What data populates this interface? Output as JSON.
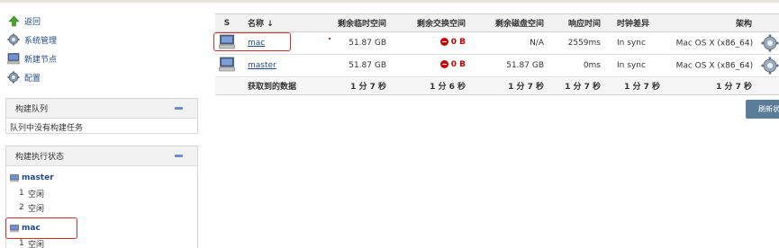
{
  "sidebar": {
    "tasks": [
      {
        "label": "返回",
        "icon": "up-arrow-icon"
      },
      {
        "label": "系统管理",
        "icon": "gear-icon"
      },
      {
        "label": "新建节点",
        "icon": "computer-icon"
      },
      {
        "label": "配置",
        "icon": "gear-icon"
      }
    ],
    "build_queue": {
      "title": "构建队列",
      "empty_text": "队列中没有构建任务"
    },
    "executor_status": {
      "title": "构建执行状态",
      "nodes": [
        {
          "name": "master",
          "executors": [
            {
              "num": "1",
              "state": "空闲"
            },
            {
              "num": "2",
              "state": "空闲"
            }
          ]
        },
        {
          "name": "mac",
          "executors": [
            {
              "num": "1",
              "state": "空闲"
            }
          ]
        }
      ]
    }
  },
  "table": {
    "headers": {
      "s": "S",
      "name": "名称 ↓",
      "temp": "剩余临时空间",
      "swap": "剩余交换空间",
      "disk": "剩余磁盘空间",
      "response": "响应时间",
      "clock": "时钟差异",
      "arch": "架构"
    },
    "rows": [
      {
        "name": "mac",
        "temp": "51.87 GB",
        "swap": "0 B",
        "disk": "N/A",
        "response": "2559ms",
        "clock": "In sync",
        "arch": "Mac OS X (x86_64)"
      },
      {
        "name": "master",
        "temp": "51.87 GB",
        "swap": "0 B",
        "disk": "51.87 GB",
        "response": "0ms",
        "clock": "In sync",
        "arch": "Mac OS X (x86_64)"
      }
    ],
    "footer": {
      "label": "获取到的数据",
      "temp": "1 分 7 秒",
      "swap": "1 分 6 秒",
      "disk": "1 分 7 秒",
      "response": "1 分 7 秒",
      "clock": "1 分 7 秒",
      "arch": "1 分 7 秒"
    }
  },
  "refresh_button": "刷新状",
  "colors": {
    "link": "#204a87",
    "error": "#cc0000",
    "highlight": "#d03030",
    "button": "#5b7d9a"
  }
}
